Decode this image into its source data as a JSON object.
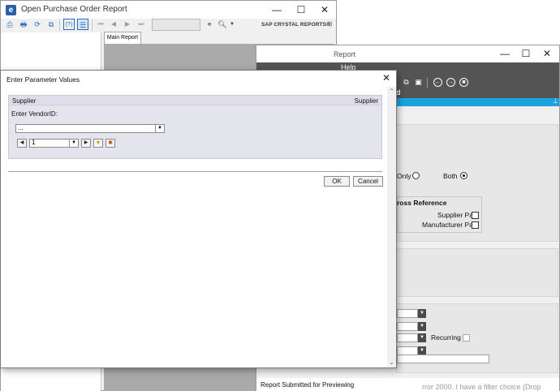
{
  "back_window": {
    "title": "Open Purchase Order Report",
    "title_icon": "crystal-app-icon",
    "window_buttons": {
      "minimize": "—",
      "maximize": "☐",
      "close": "✕"
    },
    "toolbar_icons": [
      "export-icon",
      "print-icon",
      "refresh-icon",
      "copy-icon",
      "help-icon",
      "group-tree-icon"
    ],
    "nav_glyphs": {
      "first": "⏮",
      "prev": "◀",
      "next": "▶",
      "last": "⏭"
    },
    "search_glyph": "⌖",
    "zoom_glyph": "🔍︎",
    "sap_label": "SAP CRYSTAL REPORTS®",
    "tab_label": "Main Report"
  },
  "right_window": {
    "title": "Report",
    "menu": {
      "help": "Help"
    },
    "toolbar_text": "d",
    "pin_glyph": "⊥",
    "only_label": "Only",
    "both_label": "Both",
    "selected_option": "Both",
    "cross_reference_label": "ross Reference",
    "supplier_part_label": "Supplier Part",
    "manufacturer_part_label": "Manufacturer Part",
    "recurring_label": "Recurring",
    "status_text": "Report Submitted for Previewing",
    "ghost_text": "rror 2000. I have a filter choice (Drop"
  },
  "dialog": {
    "title": "Enter Parameter Values",
    "close_glyph": "✕",
    "group_header_left": "Supplier",
    "group_header_right": "Supplier",
    "prompt": "Enter VendorID:",
    "vendor_value": "...",
    "page_value": "1",
    "ok_label": "OK",
    "cancel_label": "Cancel"
  }
}
